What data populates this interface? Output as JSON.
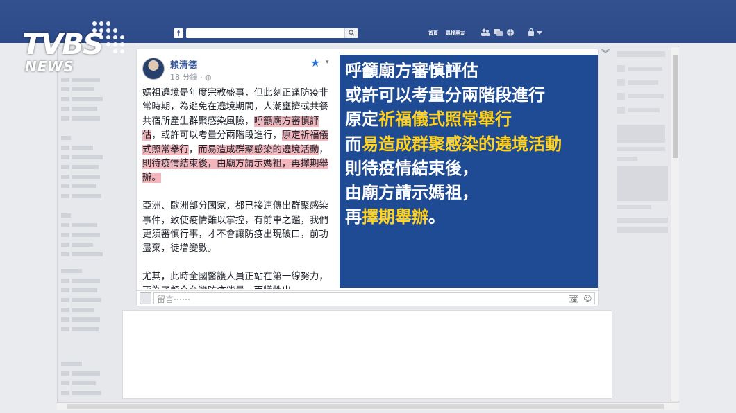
{
  "topbar": {
    "fb_logo": "f",
    "nav_home": "首頁",
    "nav_find_friends": "尋找朋友"
  },
  "overlay": {
    "logo_main": "TVBS",
    "logo_sub": "NEWS"
  },
  "post": {
    "author": "賴清德",
    "time": "18 分鐘 ·",
    "paragraph1": [
      {
        "text": "媽祖遶境是年度宗教盛事，但此刻正逢防疫非常時期，為避免在遶境期間，人潮壅擠或共餐共宿所產生群聚感染風險，",
        "hl": false
      },
      {
        "text": "呼籲廟方審慎評估",
        "hl": true
      },
      {
        "text": "，或許可以考量分兩階段進行，",
        "hl": false
      },
      {
        "text": "原定祈福儀式照常舉行",
        "hl": true
      },
      {
        "text": "，",
        "hl": false
      },
      {
        "text": "而易造成群聚感染的遶境活動",
        "hl": true
      },
      {
        "text": "，",
        "hl": false
      },
      {
        "text": "則待疫情結束後，由廟方請示媽祖，再擇期舉辦。",
        "hl": true
      }
    ],
    "paragraph2": "亞洲、歐洲部分國家，都已接連傳出群聚感染事件，致使疫情難以掌控，有前車之鑑，我們更須審慎行事，才不會讓防疫出現破口，前功盡棄，徒增變數。",
    "paragraph3": "尤其，此時全國醫護人員正站在第一線努力，更為了顧全台灣防疫能量，而犧牲出"
  },
  "image_text": {
    "l1": "呼籲廟方審慎評估",
    "l2": "或許可以考量分兩階段進行",
    "l3a": "原定",
    "l3b": "祈福儀式照常舉行",
    "l4a": "而",
    "l4b": "易造成群聚感染的遶境活動",
    "l5": "則待疫情結束後，",
    "l6": "由廟方請示媽祖，",
    "l7a": "再",
    "l7b": "擇期舉辦",
    "l7c": "。"
  },
  "comment": {
    "placeholder": "留言⋯⋯"
  },
  "colors": {
    "fb_blue": "#2d4b88",
    "image_blue": "#1f4a94",
    "highlight_yellow": "#ffd21f",
    "text_highlight_pink": "#f3b6bd"
  }
}
